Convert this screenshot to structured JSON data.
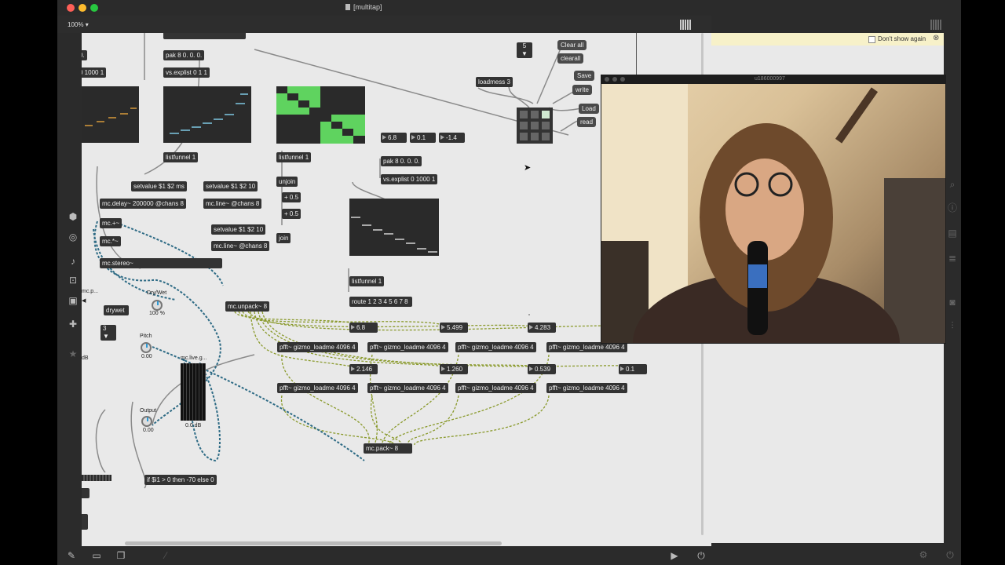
{
  "window": {
    "title": "[multitap]",
    "zoom": "100%"
  },
  "canvas": {
    "top_partial": [
      "0.",
      "0 1000 1"
    ],
    "pak1": "pak 8 0. 0. 0.",
    "explist1": "vs.explist 0 1 1",
    "listfunnel_a": "listfunnel 1",
    "listfunnel_b": "listfunnel 1",
    "unjoin": "unjoin",
    "plus1": "+ 0.5",
    "plus2": "+ 0.5",
    "join": "join",
    "num_68": "6.8",
    "num_01": "0.1",
    "num_m14": "-1.4",
    "pak2": "pak 8 0. 0. 0.",
    "explist2": "vs.explist 0 1000 1",
    "listfunnel_c": "listfunnel 1",
    "route": "route 1 2 3 4 5 6 7 8",
    "setvalue1": "setvalue $1 $2 ms",
    "setvalue2": "setvalue $1 $2 10",
    "setvalue3": "setvalue $1 $2 10",
    "mcdelay": "mc.delay~ 200000 @chans 8",
    "mcline1": "mc.line~ @chans 8",
    "mcline2": "mc.line~ @chans 8",
    "mcplus": "mc.+~",
    "mctimes": "mc.*~",
    "mcstereo": "mc.stereo~",
    "mcunpack": "mc.unpack~ 8",
    "mcpack": "mc.pack~ 8",
    "drywet_label": "Dry/Wet",
    "drywet_value": "100 %",
    "drywet_obj": "drywet",
    "pitch_label": "Pitch",
    "pitch_value": "0.00",
    "output_label": "Output",
    "output_value": "0.00",
    "gain_label": "mc.live.g...",
    "gain_value": "0.0 dB",
    "left_partial": "mc.p...",
    "num_3": "3",
    "num_5": "5",
    "ifexpr": "if $i1 > 0 then -70 else 0",
    "loadmess": "loadmess 3",
    "clear_all": "Clear all",
    "clearall": "clearall",
    "save": "Save",
    "write": "write",
    "load": "Load",
    "read": "read",
    "row1_nums": [
      "6.8",
      "5.499",
      "4.283"
    ],
    "row2_nums": [
      "2.146",
      "1.260",
      "0.539",
      "0.1"
    ],
    "pfft": "pfft~ gizmo_loadme 4096 4",
    "db_label": "dB"
  },
  "right_panel": {
    "dont_show": "Don't show again"
  },
  "video": {
    "title": "u186000997"
  }
}
